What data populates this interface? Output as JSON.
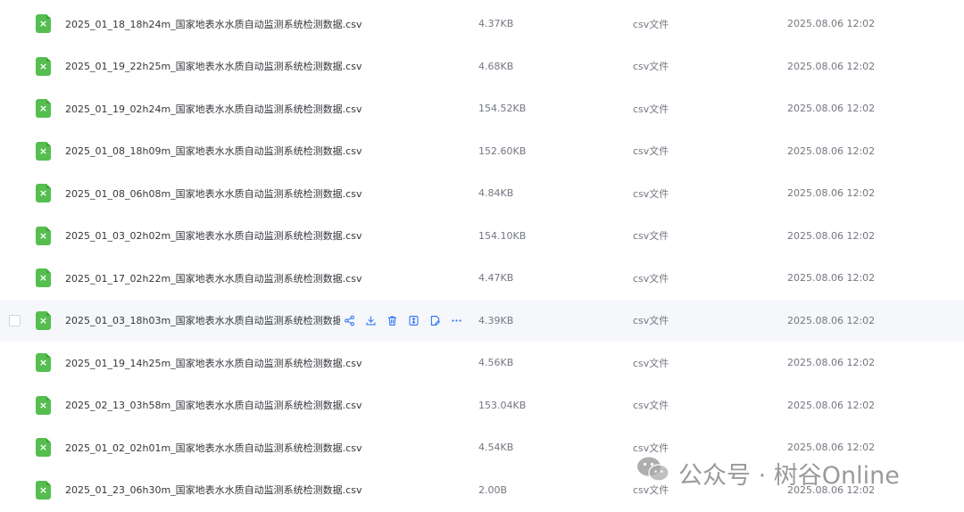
{
  "files": [
    {
      "name": "2025_01_18_18h24m_国家地表水水质自动监测系统检测数据.csv",
      "size": "4.37KB",
      "type": "csv文件",
      "modified": "2025.08.06 12:02"
    },
    {
      "name": "2025_01_19_22h25m_国家地表水水质自动监测系统检测数据.csv",
      "size": "4.68KB",
      "type": "csv文件",
      "modified": "2025.08.06 12:02"
    },
    {
      "name": "2025_01_19_02h24m_国家地表水水质自动监测系统检测数据.csv",
      "size": "154.52KB",
      "type": "csv文件",
      "modified": "2025.08.06 12:02"
    },
    {
      "name": "2025_01_08_18h09m_国家地表水水质自动监测系统检测数据.csv",
      "size": "152.60KB",
      "type": "csv文件",
      "modified": "2025.08.06 12:02"
    },
    {
      "name": "2025_01_08_06h08m_国家地表水水质自动监测系统检测数据.csv",
      "size": "4.84KB",
      "type": "csv文件",
      "modified": "2025.08.06 12:02"
    },
    {
      "name": "2025_01_03_02h02m_国家地表水水质自动监测系统检测数据.csv",
      "size": "154.10KB",
      "type": "csv文件",
      "modified": "2025.08.06 12:02"
    },
    {
      "name": "2025_01_17_02h22m_国家地表水水质自动监测系统检测数据.csv",
      "size": "4.47KB",
      "type": "csv文件",
      "modified": "2025.08.06 12:02"
    },
    {
      "name": "2025_01_03_18h03m_国家地表水水质自动监测系统检测数据",
      "size": "4.39KB",
      "type": "csv文件",
      "modified": "2025.08.06 12:02"
    },
    {
      "name": "2025_01_19_14h25m_国家地表水水质自动监测系统检测数据.csv",
      "size": "4.56KB",
      "type": "csv文件",
      "modified": "2025.08.06 12:02"
    },
    {
      "name": "2025_02_13_03h58m_国家地表水水质自动监测系统检测数据.csv",
      "size": "153.04KB",
      "type": "csv文件",
      "modified": "2025.08.06 12:02"
    },
    {
      "name": "2025_01_02_02h01m_国家地表水水质自动监测系统检测数据.csv",
      "size": "4.54KB",
      "type": "csv文件",
      "modified": "2025.08.06 12:02"
    },
    {
      "name": "2025_01_23_06h30m_国家地表水水质自动监测系统检测数据.csv",
      "size": "2.00B",
      "type": "csv文件",
      "modified": "2025.08.06 12:02"
    }
  ],
  "hovered_row": 7,
  "icons": {
    "file": "excel-file-icon",
    "actions": [
      "share-icon",
      "download-icon",
      "delete-icon",
      "move-icon",
      "rename-icon",
      "more-icon"
    ]
  },
  "colors": {
    "file_icon": "#55be4f",
    "action_icon": "#3a7cf5",
    "hover_bg": "#f5f7fb"
  },
  "watermark": {
    "text": "公众号 · 树谷Online"
  }
}
